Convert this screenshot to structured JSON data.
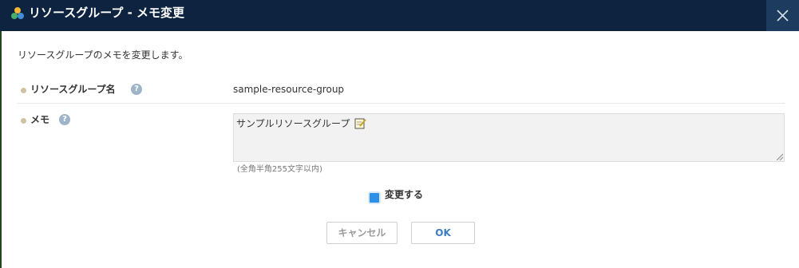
{
  "dialog": {
    "title": "リソースグループ - メモ変更",
    "close_icon": "close-icon",
    "app_icon": "resource-group-icon",
    "description": "リソースグループのメモを変更します。"
  },
  "fields": {
    "resource_group_name": {
      "label": "リソースグループ名",
      "help": "?",
      "value": "sample-resource-group"
    },
    "memo": {
      "label": "メモ",
      "help": "?",
      "value": "サンプルリソースグループ",
      "note_icon": "edit-note-icon",
      "limit_hint": "(全角半角255文字以内)"
    }
  },
  "change_checkbox": {
    "label": "変更する",
    "checked": true
  },
  "buttons": {
    "cancel": "キャンセル",
    "ok": "OK"
  },
  "colors": {
    "titlebar": "#0d2340",
    "close_button": "#1d3a5f",
    "checkbox": "#2c8fe8",
    "ok_text": "#3a7dc0"
  }
}
